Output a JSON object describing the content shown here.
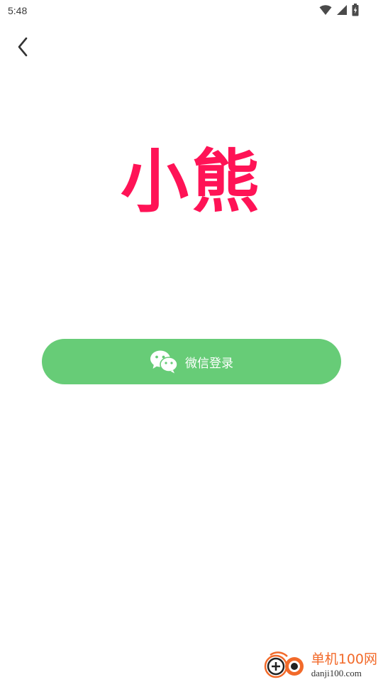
{
  "status_bar": {
    "time": "5:48",
    "icons": [
      "wifi-icon",
      "signal-icon",
      "battery-charging-icon"
    ]
  },
  "nav": {
    "back_icon": "chevron-left-icon"
  },
  "logo": {
    "text": "小熊",
    "color": "#ff1356"
  },
  "login": {
    "wechat_label": "微信登录",
    "button_color": "#67cc77",
    "icon": "wechat-icon"
  },
  "watermark": {
    "cn": "单机100网",
    "en": "danji100.com",
    "accent": "#f26a2a"
  }
}
